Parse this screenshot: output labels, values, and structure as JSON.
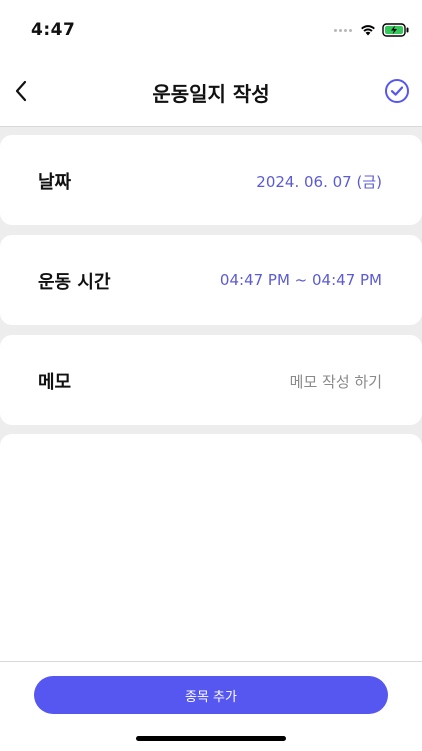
{
  "status_bar": {
    "time": "4:47"
  },
  "header": {
    "title": "운동일지 작성",
    "icons": {
      "back": "chevron-left-icon",
      "confirm": "check-circle-icon"
    }
  },
  "fields": {
    "date": {
      "label": "날짜",
      "value": "2024. 06. 07 (금)"
    },
    "workout_time": {
      "label": "운동 시간",
      "value": "04:47  PM ~ 04:47  PM"
    },
    "memo": {
      "label": "메모",
      "placeholder": "메모 작성 하기"
    }
  },
  "footer": {
    "add_exercise_label": "종목 추가"
  },
  "colors": {
    "accent": "#5656f0",
    "value_text": "#5b5bd6",
    "placeholder_text": "#8a8a8a",
    "background": "#ededed"
  }
}
